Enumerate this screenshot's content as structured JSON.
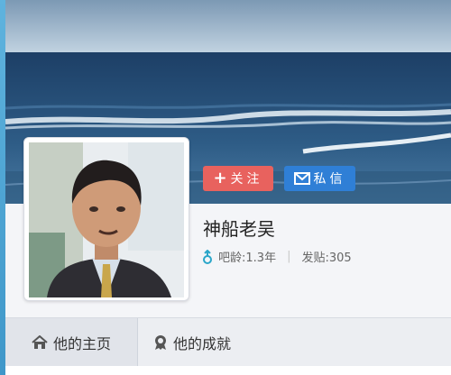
{
  "profile": {
    "username": "神船老吴",
    "age_label": "吧龄:",
    "age_value": "1.3年",
    "posts_label": "发贴:",
    "posts_value": "305"
  },
  "actions": {
    "follow_label": "关注",
    "message_label": "私信"
  },
  "tabs": [
    {
      "label": "他的主页",
      "icon": "home-icon"
    },
    {
      "label": "他的成就",
      "icon": "award-icon"
    }
  ],
  "colors": {
    "follow_button": "#e8625e",
    "message_button": "#2f7fd6",
    "gender_icon": "#2aa6c9"
  }
}
